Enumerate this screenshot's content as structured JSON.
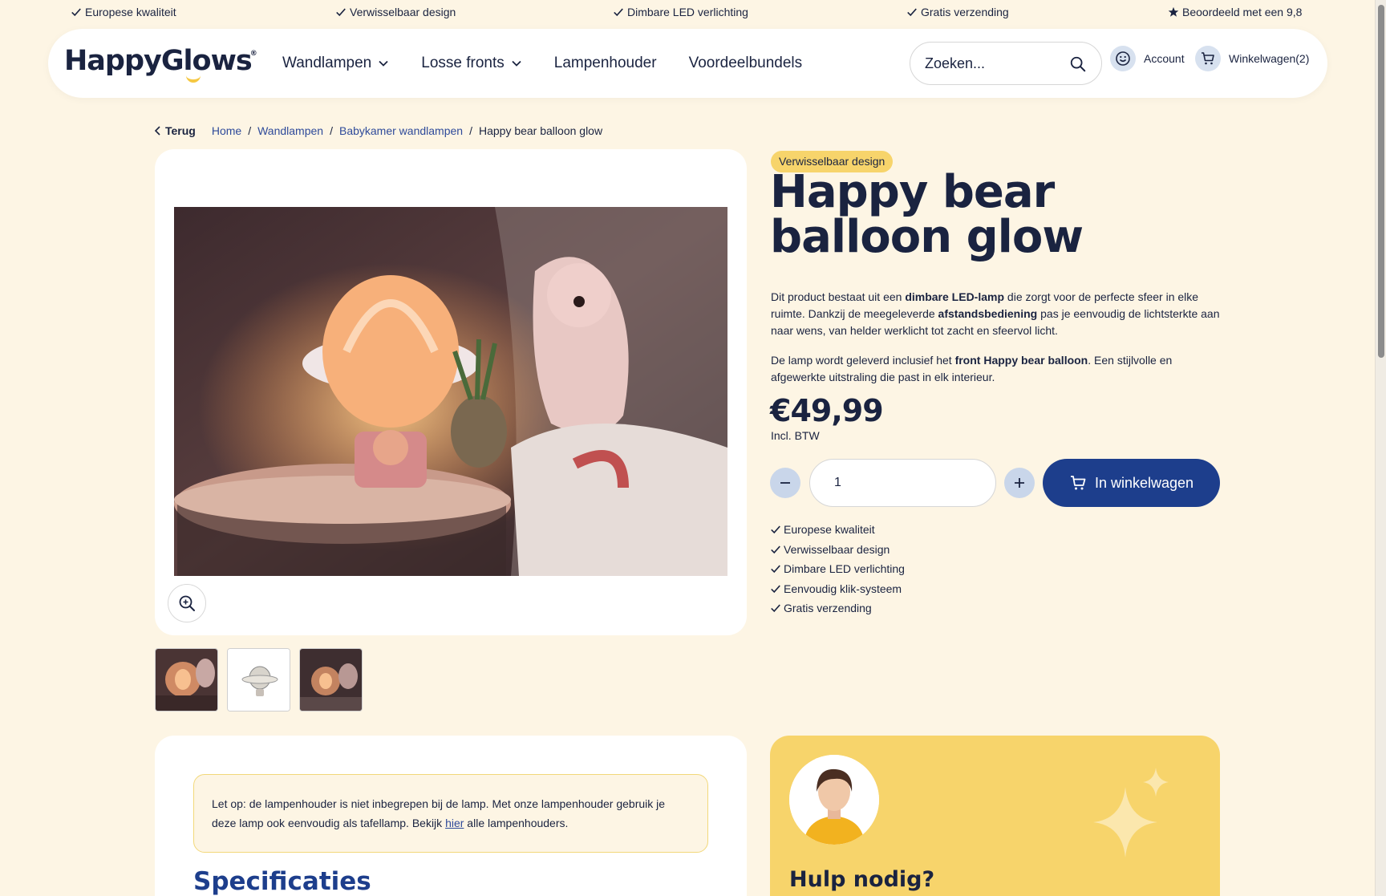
{
  "usp_bar": [
    {
      "icon": "check-icon",
      "label": "Europese kwaliteit"
    },
    {
      "icon": "check-icon",
      "label": "Verwisselbaar design"
    },
    {
      "icon": "check-icon",
      "label": "Dimbare LED verlichting"
    },
    {
      "icon": "check-icon",
      "label": "Gratis verzending"
    },
    {
      "icon": "star-icon",
      "label": "Beoordeeld met een 9,8"
    }
  ],
  "header": {
    "logo": "HappyGlows",
    "nav": [
      {
        "label": "Wandlampen",
        "dropdown": true
      },
      {
        "label": "Losse fronts",
        "dropdown": true
      },
      {
        "label": "Lampenhouder",
        "dropdown": false
      },
      {
        "label": "Voordeelbundels",
        "dropdown": false
      }
    ],
    "search_placeholder": "Zoeken...",
    "account_label": "Account",
    "cart_label": "Winkelwagen(2)"
  },
  "breadcrumb": {
    "back": "Terug",
    "items": [
      "Home",
      "Wandlampen",
      "Babykamer wandlampen"
    ],
    "current": "Happy bear balloon glow"
  },
  "product": {
    "badge": "Verwisselbaar design",
    "title": "Happy bear balloon glow",
    "desc1": {
      "p1": "Dit product bestaat uit een ",
      "b1": "dimbare LED-lamp",
      "p2": " die zorgt voor de perfecte sfeer in elke ruimte. Dankzij de meegeleverde ",
      "b2": "afstandsbediening",
      "p3": " pas je eenvoudig de lichtsterkte aan naar wens, van helder werklicht tot zacht en sfeervol licht."
    },
    "desc2": {
      "p1": "De lamp wordt geleverd inclusief het ",
      "b1": "front Happy bear balloon",
      "p2": ". Een stijlvolle en afgewerkte uitstraling die past in elk interieur."
    },
    "price": "€49,99",
    "price_note": "Incl. BTW",
    "quantity": "1",
    "add_to_cart": "In winkelwagen",
    "usps": [
      "Europese kwaliteit",
      "Verwisselbaar design",
      "Dimbare LED verlichting",
      "Eenvoudig klik-systeem",
      "Gratis verzending"
    ]
  },
  "notice": {
    "text1": "Let op: de lampenhouder is niet inbegrepen bij de lamp. Met onze lampenhouder gebruik je deze lamp ook eenvoudig als tafellamp. Bekijk ",
    "link": "hier",
    "text2": " alle lampenhouders."
  },
  "specs_title": "Specificaties",
  "help_title": "Hulp nodig?",
  "colors": {
    "background": "#fdf5e4",
    "primary": "#1d3e8c",
    "accent": "#f7d46b",
    "text": "#1a2340"
  }
}
